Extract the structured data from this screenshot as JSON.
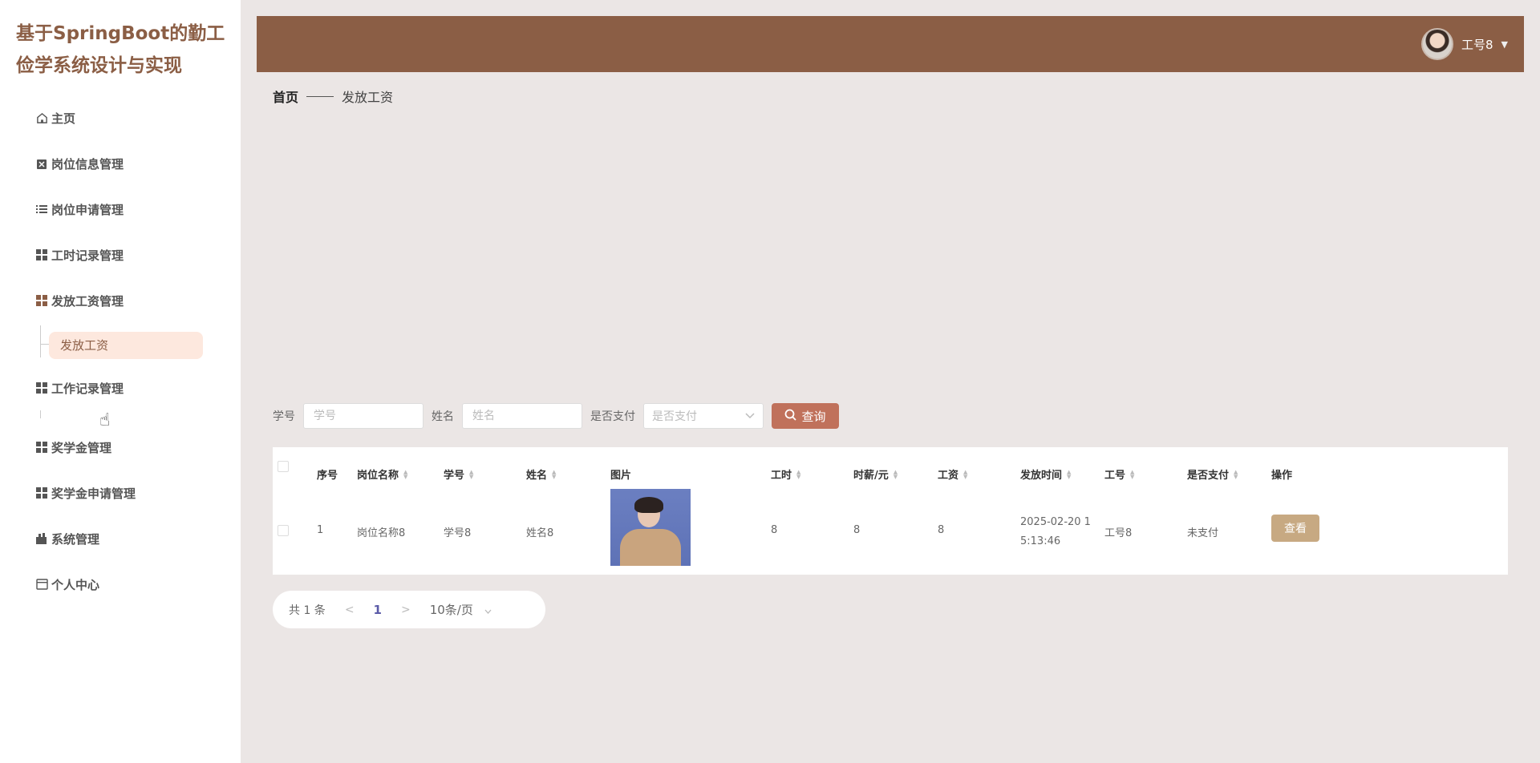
{
  "app": {
    "title": "基于SpringBoot的勤工俭学系统设计与实现"
  },
  "sidebar": {
    "items": [
      {
        "label": "主页",
        "icon": "home-icon"
      },
      {
        "label": "岗位信息管理",
        "icon": "clipboard-icon"
      },
      {
        "label": "岗位申请管理",
        "icon": "list-icon"
      },
      {
        "label": "工时记录管理",
        "icon": "grid-icon"
      },
      {
        "label": "发放工资管理",
        "icon": "grid-icon"
      },
      {
        "label": "工作记录管理",
        "icon": "grid-icon"
      },
      {
        "label": "奖学金管理",
        "icon": "grid-icon"
      },
      {
        "label": "奖学金申请管理",
        "icon": "grid-icon"
      },
      {
        "label": "系统管理",
        "icon": "settings-icon"
      },
      {
        "label": "个人中心",
        "icon": "calendar-icon"
      }
    ],
    "submenu_item": "发放工资"
  },
  "header": {
    "username": "工号8"
  },
  "breadcrumb": {
    "home": "首页",
    "current": "发放工资"
  },
  "search": {
    "label_student_no": "学号",
    "placeholder_student_no": "学号",
    "label_name": "姓名",
    "placeholder_name": "姓名",
    "label_paid": "是否支付",
    "placeholder_paid": "是否支付",
    "query_label": "查询"
  },
  "table": {
    "headers": [
      "序号",
      "岗位名称",
      "学号",
      "姓名",
      "图片",
      "工时",
      "时薪/元",
      "工资",
      "发放时间",
      "工号",
      "是否支付",
      "操作"
    ],
    "rows": [
      {
        "index": "1",
        "position": "岗位名称8",
        "student_no": "学号8",
        "name": "姓名8",
        "hours": "8",
        "hourly_wage": "8",
        "wage": "8",
        "pay_time": "2025-02-20 15:13:46",
        "pay_time_line1": "2025-02-20 1",
        "pay_time_line2": "5:13:46",
        "employee_no": "工号8",
        "paid": "未支付",
        "action": "查看"
      }
    ]
  },
  "pagination": {
    "total": "共 1 条",
    "prev": "<",
    "page": "1",
    "next": ">",
    "page_size": "10条/页"
  },
  "colors": {
    "brand": "#8b5e45",
    "accent": "#c0715b",
    "view_button": "#c7a982",
    "background": "#ebe6e5"
  }
}
